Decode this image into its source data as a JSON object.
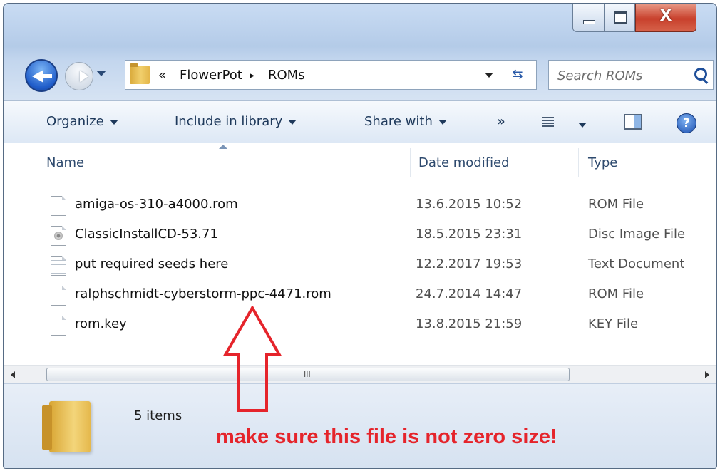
{
  "window": {
    "close_glyph": "X"
  },
  "address_bar": {
    "overflow_glyph": "«",
    "crumbs": [
      "FlowerPot",
      "ROMs"
    ],
    "separator": "▸",
    "refresh_glyph": "⇆"
  },
  "search": {
    "placeholder": "Search ROMs"
  },
  "toolbar": {
    "organize": "Organize",
    "include_in_library": "Include in library",
    "share_with": "Share with",
    "more": "»",
    "help_glyph": "?"
  },
  "columns": {
    "name": "Name",
    "date_modified": "Date modified",
    "type": "Type"
  },
  "files": [
    {
      "name": "amiga-os-310-a4000.rom",
      "date": "13.6.2015 10:52",
      "type": "ROM File",
      "icon": "blank-file-icon"
    },
    {
      "name": "ClassicInstallCD-53.71",
      "date": "18.5.2015 23:31",
      "type": "Disc Image File",
      "icon": "disc-image-file-icon"
    },
    {
      "name": "put required seeds here",
      "date": "12.2.2017 19:53",
      "type": "Text Document",
      "icon": "text-file-icon"
    },
    {
      "name": "ralphschmidt-cyberstorm-ppc-4471.rom",
      "date": "24.7.2014 14:47",
      "type": "ROM File",
      "icon": "blank-file-icon"
    },
    {
      "name": "rom.key",
      "date": "13.8.2015 21:59",
      "type": "KEY File",
      "icon": "blank-file-icon"
    }
  ],
  "scrollbar": {
    "grip": "III"
  },
  "details": {
    "item_count": "5 items"
  },
  "annotation": {
    "text": "make sure this file is not zero size!",
    "color": "#e5242b"
  }
}
